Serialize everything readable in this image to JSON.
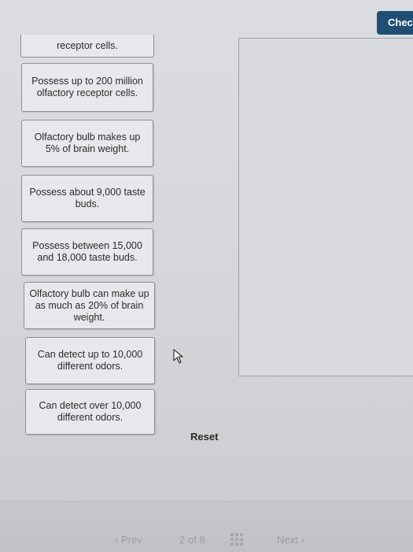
{
  "header": {
    "check_label": "Check"
  },
  "cards": [
    {
      "text": "receptor cells."
    },
    {
      "text": "Possess up to 200 million olfactory receptor cells."
    },
    {
      "text": "Olfactory bulb makes up 5% of brain weight."
    },
    {
      "text": "Possess about 9,000 taste buds."
    },
    {
      "text": "Possess between 15,000 and 18,000 taste buds."
    },
    {
      "text": "Olfactory bulb can make up as much as 20% of brain weight."
    },
    {
      "text": "Can detect up to 10,000 different odors."
    },
    {
      "text": "Can detect over 10,000 different odors."
    }
  ],
  "controls": {
    "reset_label": "Reset"
  },
  "footer": {
    "prev_label": "Prev",
    "page_current": "2",
    "page_of": "of",
    "page_total": "8",
    "next_label": "Next"
  },
  "icons": {
    "prev": "chevron-left-icon",
    "next": "chevron-right-icon",
    "grid": "grid-icon",
    "cursor": "mouse-pointer-icon"
  },
  "colors": {
    "check_bg": "#1f4f73",
    "card_bg": "#e7e8eb",
    "page_bg": "#d7d9dd"
  }
}
